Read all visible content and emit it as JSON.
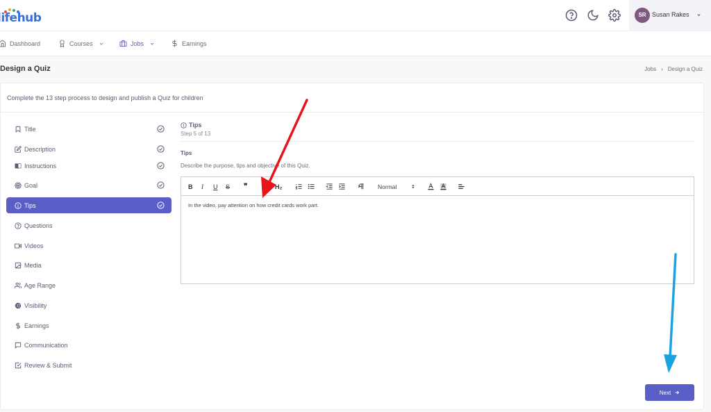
{
  "app": {
    "logo_text": "lifehub"
  },
  "header": {
    "help_icon": "help-circle-icon",
    "theme_icon": "moon-icon",
    "settings_icon": "gear-icon",
    "user": {
      "initials": "SR",
      "name": "Susan Rakes"
    }
  },
  "nav": {
    "items": [
      {
        "label": "Dashboard",
        "icon": "home-icon"
      },
      {
        "label": "Courses",
        "icon": "award-icon",
        "has_dropdown": true
      },
      {
        "label": "Jobs",
        "icon": "briefcase-icon",
        "has_dropdown": true,
        "active": true
      },
      {
        "label": "Earnings",
        "icon": "dollar-icon"
      }
    ]
  },
  "page": {
    "title": "Design a Quiz",
    "breadcrumb": [
      "Jobs",
      "Design a Quiz"
    ]
  },
  "card": {
    "description": "Complete the 13 step process to design and publish a Quiz for children"
  },
  "steps": [
    {
      "label": "Title",
      "icon": "bookmark-icon",
      "completed": true
    },
    {
      "label": "Description",
      "icon": "edit-icon",
      "completed": true
    },
    {
      "label": "Instructions",
      "icon": "book-open-icon",
      "completed": true
    },
    {
      "label": "Goal",
      "icon": "target-icon",
      "completed": true
    },
    {
      "label": "Tips",
      "icon": "alert-circle-icon",
      "completed": true,
      "active": true
    },
    {
      "label": "Questions",
      "icon": "help-circle-icon",
      "completed": false
    },
    {
      "label": "Videos",
      "icon": "video-icon",
      "completed": false
    },
    {
      "label": "Media",
      "icon": "image-icon",
      "completed": false
    },
    {
      "label": "Age Range",
      "icon": "users-icon",
      "completed": false
    },
    {
      "label": "Visibility",
      "icon": "globe-icon",
      "completed": false
    },
    {
      "label": "Earnings",
      "icon": "dollar-icon",
      "completed": false
    },
    {
      "label": "Communication",
      "icon": "message-square-icon",
      "completed": false
    },
    {
      "label": "Review & Submit",
      "icon": "check-square-icon",
      "completed": false
    }
  ],
  "section": {
    "title": "Tips",
    "subtitle": "Step 5 of 13",
    "field_label": "Tips",
    "field_help": "Describe the purpose, tips and objective of this Quiz."
  },
  "editor": {
    "toolbar": {
      "bold": "B",
      "italic": "I",
      "underline": "U",
      "strike": "S",
      "quote": "❞",
      "h1": "H₁",
      "h2": "H₂",
      "format_select": "Normal"
    },
    "content": "In the video, pay attention on how credit cards work part."
  },
  "actions": {
    "next_label": "Next"
  },
  "colors": {
    "primary": "#5a5fc7",
    "annotation_red": "#e8141b",
    "annotation_blue": "#1aa3e0"
  }
}
